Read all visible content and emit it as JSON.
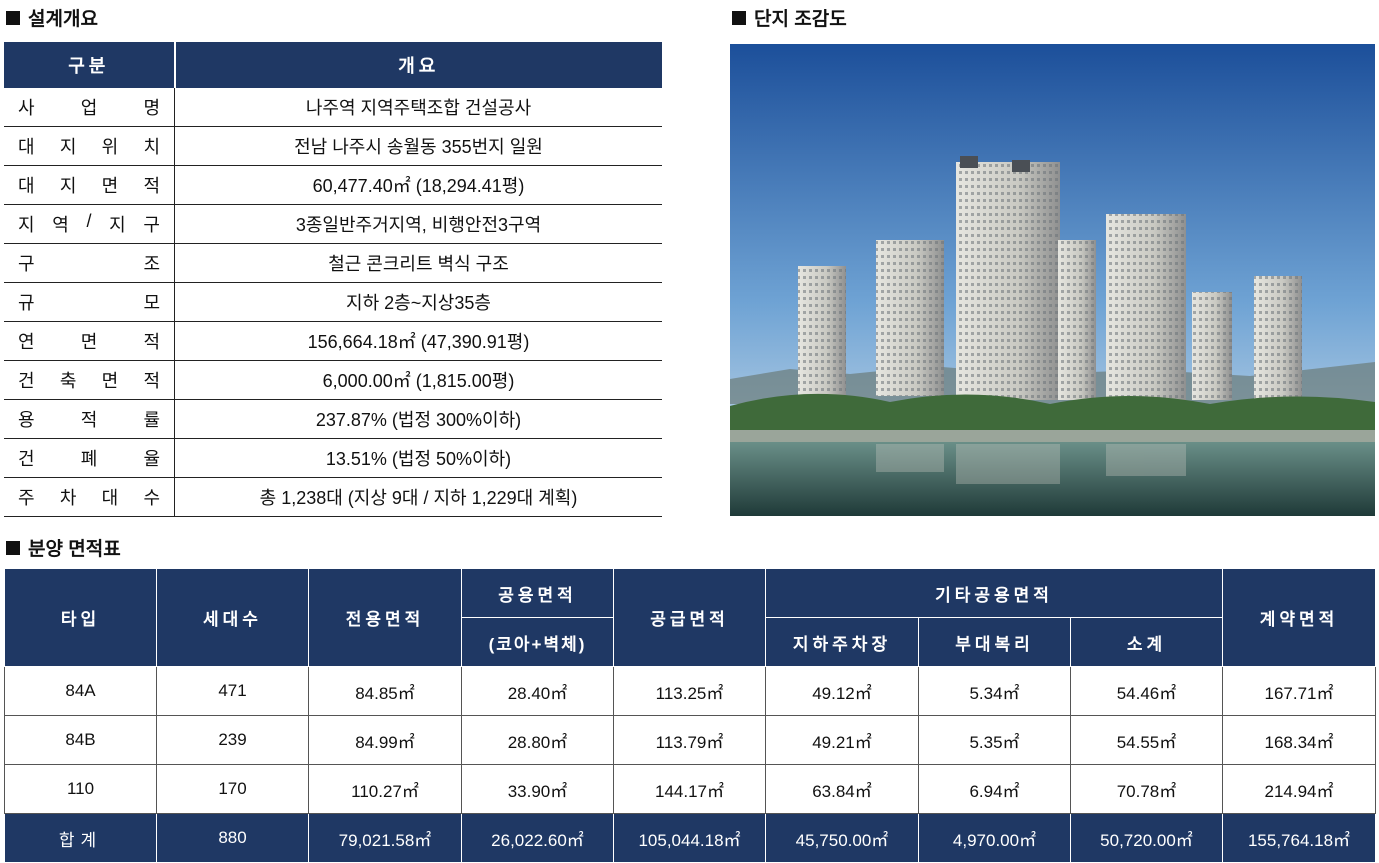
{
  "sections": {
    "overview_title": "설계개요",
    "birdseye_title": "단지 조감도",
    "area_title": "분양 면적표"
  },
  "overview": {
    "headers": [
      "구분",
      "개요"
    ],
    "rows": [
      {
        "label": "사업명",
        "value": "나주역 지역주택조합 건설공사"
      },
      {
        "label": "대지위치",
        "value": "전남 나주시 송월동 355번지 일원"
      },
      {
        "label": "대지면적",
        "value": "60,477.40㎡ (18,294.41평)"
      },
      {
        "label": "지역/지구",
        "value": "3종일반주거지역, 비행안전3구역"
      },
      {
        "label": "구조",
        "value": "철근 콘크리트 벽식 구조"
      },
      {
        "label": "규모",
        "value": "지하 2층~지상35층"
      },
      {
        "label": "연면적",
        "value": "156,664.18㎡ (47,390.91평)"
      },
      {
        "label": "건축면적",
        "value": "6,000.00㎡ (1,815.00평)"
      },
      {
        "label": "용적률",
        "value": "237.87% (법정 300%이하)"
      },
      {
        "label": "건폐율",
        "value": "13.51% (법정 50%이하)"
      },
      {
        "label": "주차대수",
        "value": "총 1,238대 (지상 9대 / 지하 1,229대 계획)"
      }
    ]
  },
  "area": {
    "headers": {
      "type": "타입",
      "households": "세대수",
      "exclusive": "전용면적",
      "common": "공용면적",
      "common_sub": "(코아+벽체)",
      "supply": "공급면적",
      "other": "기타공용면적",
      "parking": "지하주차장",
      "amenity": "부대복리",
      "subtotal": "소계",
      "contract": "계약면적"
    },
    "rows": [
      [
        "84A",
        "471",
        "84.85㎡",
        "28.40㎡",
        "113.25㎡",
        "49.12㎡",
        "5.34㎡",
        "54.46㎡",
        "167.71㎡"
      ],
      [
        "84B",
        "239",
        "84.99㎡",
        "28.80㎡",
        "113.79㎡",
        "49.21㎡",
        "5.35㎡",
        "54.55㎡",
        "168.34㎡"
      ],
      [
        "110",
        "170",
        "110.27㎡",
        "33.90㎡",
        "144.17㎡",
        "63.84㎡",
        "6.94㎡",
        "70.78㎡",
        "214.94㎡"
      ]
    ],
    "total": [
      "합계",
      "880",
      "79,021.58㎡",
      "26,022.60㎡",
      "105,044.18㎡",
      "45,750.00㎡",
      "4,970.00㎡",
      "50,720.00㎡",
      "155,764.18㎡"
    ]
  },
  "colors": {
    "header_bg": "#1f3864"
  }
}
